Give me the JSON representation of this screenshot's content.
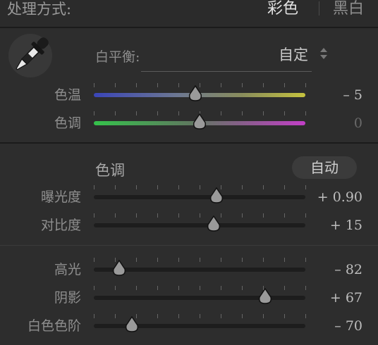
{
  "header": {
    "title": "处理方式:",
    "mode_color": "彩色",
    "mode_bw": "黑白"
  },
  "white_balance": {
    "label": "白平衡:",
    "preset": "自定"
  },
  "sliders_wb": [
    {
      "label": "色温",
      "value_text": "– 5",
      "position": 0.48
    },
    {
      "label": "色调",
      "value_text": "0",
      "position": 0.5
    }
  ],
  "tone": {
    "title": "色调",
    "auto_label": "自动"
  },
  "sliders_tone": [
    {
      "label": "曝光度",
      "value_text": "+ 0.90",
      "position": 0.58
    },
    {
      "label": "对比度",
      "value_text": "+ 15",
      "position": 0.565
    }
  ],
  "sliders_presence": [
    {
      "label": "高光",
      "value_text": "– 82",
      "position": 0.12
    },
    {
      "label": "阴影",
      "value_text": "+ 67",
      "position": 0.81
    },
    {
      "label": "白色色阶",
      "value_text": "– 70",
      "position": 0.18
    }
  ],
  "colors": {
    "background": "#2d2d2d",
    "active_mode": "#e2e2e2",
    "inactive_mode": "#8e8e8e"
  }
}
